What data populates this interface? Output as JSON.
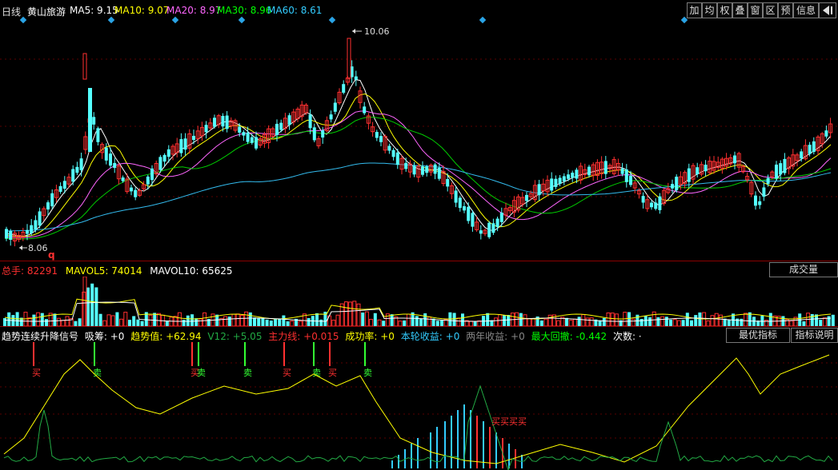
{
  "header": {
    "period_label": "日线",
    "stock_name": "黄山旅游",
    "ma": [
      {
        "label": "MA5: 9.15",
        "color": "#ffffff"
      },
      {
        "label": "MA10: 9.07",
        "color": "#ffff00"
      },
      {
        "label": "MA20: 8.97",
        "color": "#ff66ff"
      },
      {
        "label": "MA30: 8.96",
        "color": "#00ff00"
      },
      {
        "label": "MA60: 8.61",
        "color": "#33ccff"
      }
    ],
    "toolbar": [
      "加",
      "均",
      "权",
      "叠",
      "窗",
      "区",
      "预"
    ],
    "info_label": "信息",
    "back_icon": "back-arrow-icon"
  },
  "price_chart": {
    "high_label": "10.06",
    "low_label": "8.06",
    "q_marker": "q"
  },
  "volume_panel": {
    "legend": [
      {
        "label": "总手: 82291",
        "color": "#ff3030"
      },
      {
        "label": "MAVOL5: 74014",
        "color": "#ffff00"
      },
      {
        "label": "MAVOL10: 65625",
        "color": "#ffffff"
      }
    ],
    "selector_label": "成交量"
  },
  "indicator_panel": {
    "legend": [
      {
        "label": "趋势连续升降信号",
        "color": "#ffffff"
      },
      {
        "label": "吸筹: +0",
        "color": "#ffffff"
      },
      {
        "label": "趋势值: +62.94",
        "color": "#ffff00"
      },
      {
        "label": "V12: +5.05",
        "color": "#22aa44"
      },
      {
        "label": "主力线: +0.015",
        "color": "#ff3030"
      },
      {
        "label": "成功率: +0",
        "color": "#ffff00"
      },
      {
        "label": "本轮收益: +0",
        "color": "#33ccff"
      },
      {
        "label": "两年收益: +0",
        "color": "#888888"
      },
      {
        "label": "最大回撤: -0.442",
        "color": "#00ff00"
      },
      {
        "label": "次数: ·",
        "color": "#ffffff"
      }
    ],
    "best_button": "最优指标",
    "explain_button": "指标说明",
    "buy_label": "买",
    "sell_label": "卖",
    "cluster_label": "买买买买"
  }
}
